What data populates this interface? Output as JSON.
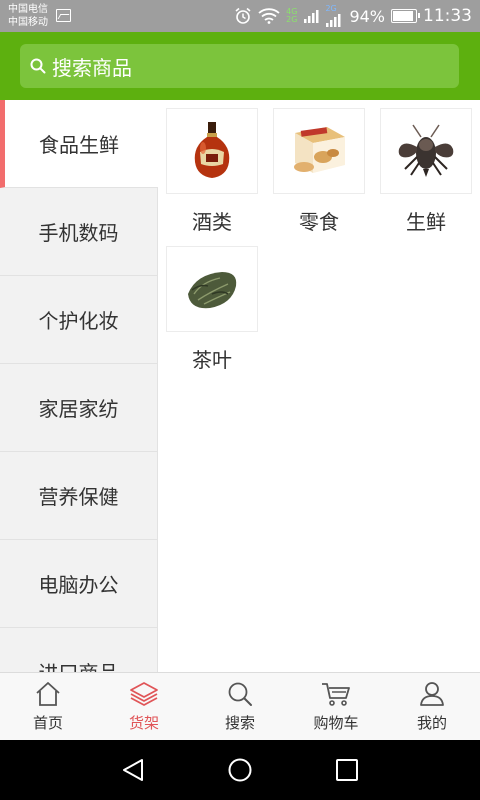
{
  "status_bar": {
    "carrier_1": "中国电信",
    "carrier_2": "中国移动",
    "net_1": "4G",
    "net_2": "2G",
    "net_3": "2G",
    "battery": "94%",
    "time": "11:33"
  },
  "search": {
    "placeholder": "搜索商品"
  },
  "categories": [
    {
      "label": "食品生鲜",
      "active": true
    },
    {
      "label": "手机数码",
      "active": false
    },
    {
      "label": "个护化妆",
      "active": false
    },
    {
      "label": "家居家纺",
      "active": false
    },
    {
      "label": "营养保健",
      "active": false
    },
    {
      "label": "电脑办公",
      "active": false
    },
    {
      "label": "进口商品",
      "active": false
    }
  ],
  "products": [
    {
      "label": "酒类",
      "icon": "liquor-bottle-icon"
    },
    {
      "label": "零食",
      "icon": "snack-box-icon"
    },
    {
      "label": "生鲜",
      "icon": "lobster-icon"
    },
    {
      "label": "茶叶",
      "icon": "tea-leaves-icon"
    }
  ],
  "bottom_nav": [
    {
      "label": "首页",
      "icon": "home-icon"
    },
    {
      "label": "货架",
      "icon": "shelf-layers-icon",
      "active": true
    },
    {
      "label": "搜索",
      "icon": "search-icon"
    },
    {
      "label": "购物车",
      "icon": "cart-icon"
    },
    {
      "label": "我的",
      "icon": "user-icon"
    }
  ],
  "colors": {
    "header_green": "#5db00f",
    "active_red": "#e05558",
    "active_bar": "#f26d6d"
  }
}
